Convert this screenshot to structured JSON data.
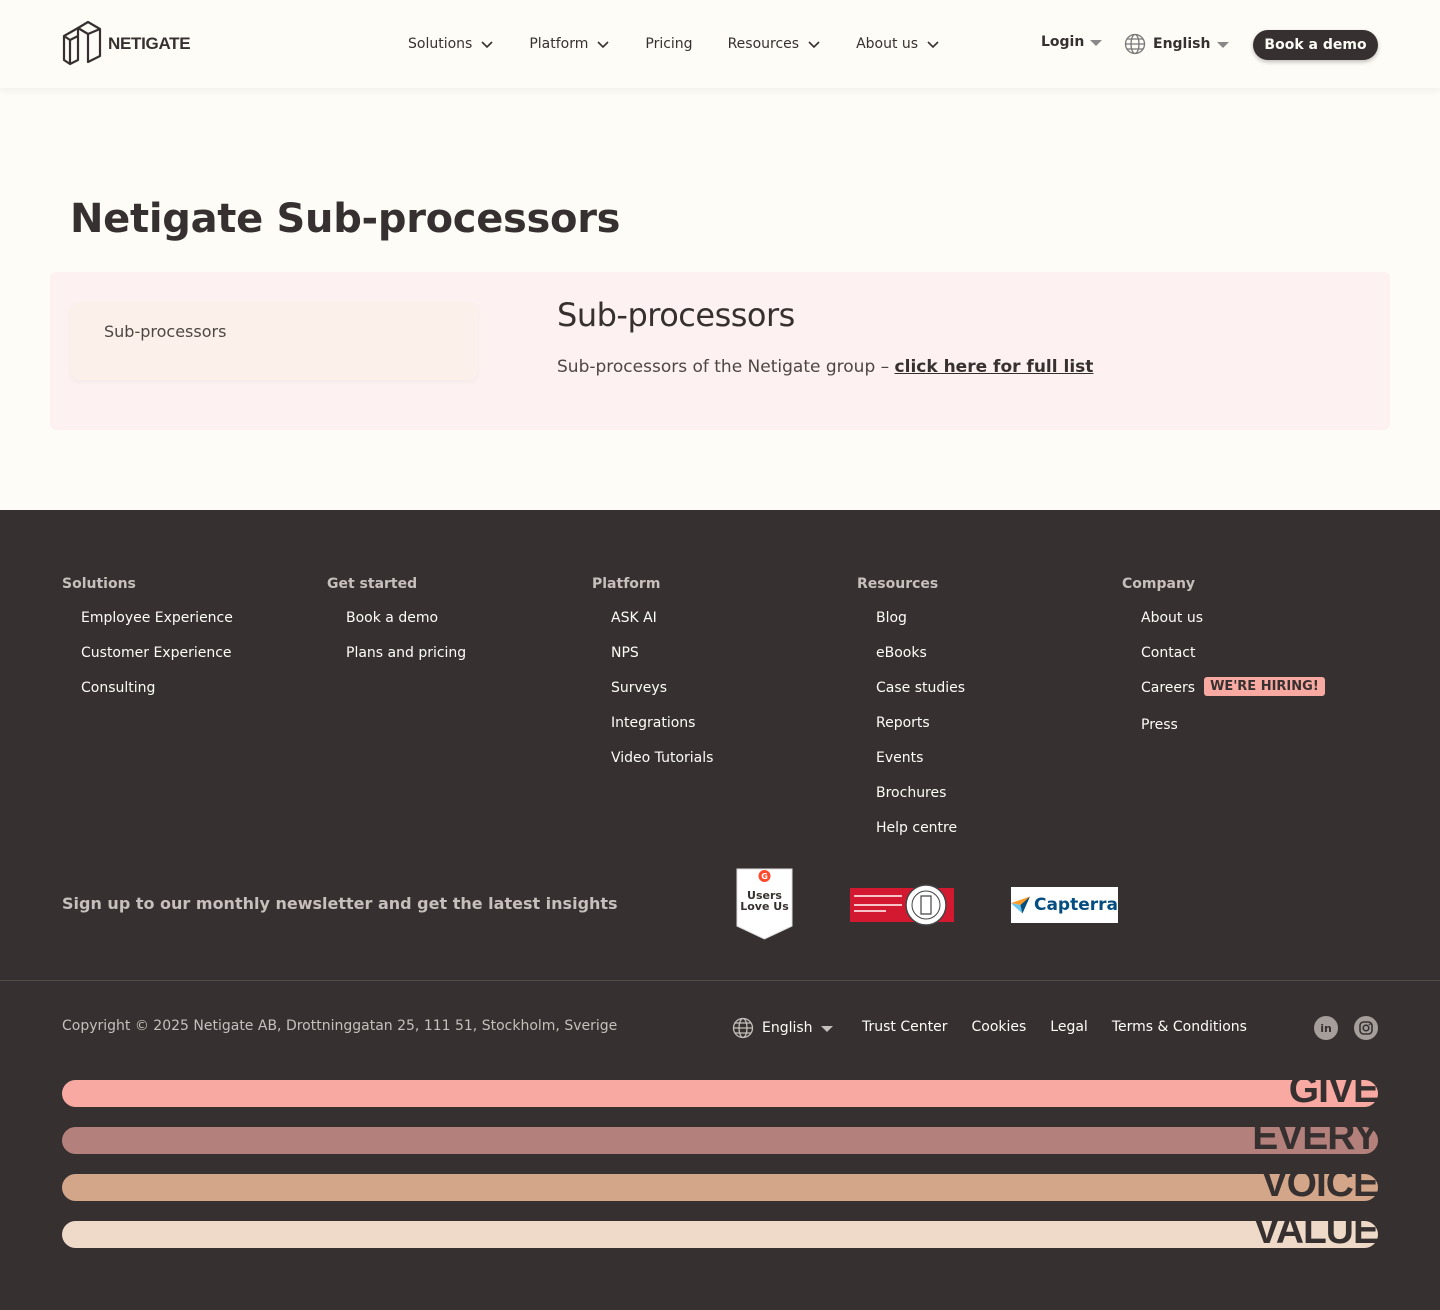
{
  "header": {
    "logo_text": "NETIGATE",
    "nav": [
      {
        "label": "Solutions",
        "has_dropdown": true
      },
      {
        "label": "Platform",
        "has_dropdown": true
      },
      {
        "label": "Pricing",
        "has_dropdown": false
      },
      {
        "label": "Resources",
        "has_dropdown": true
      },
      {
        "label": "About us",
        "has_dropdown": true
      }
    ],
    "login_label": "Login",
    "language_label": "English",
    "demo_button": "Book a demo"
  },
  "main": {
    "page_title": "Netigate Sub-processors",
    "side_menu": [
      "Sub-processors"
    ],
    "section_title": "Sub-processors",
    "section_text": "Sub-processors of the Netigate group – ",
    "section_link": "click here for full list"
  },
  "footer": {
    "columns": [
      {
        "title": "Solutions",
        "items": [
          "Employee Experience",
          "Customer Experience",
          "Consulting"
        ]
      },
      {
        "title": "Get started",
        "items": [
          "Book a demo",
          "Plans and pricing"
        ]
      },
      {
        "title": "Platform",
        "items": [
          "ASK AI",
          "NPS",
          "Surveys",
          "Integrations",
          "Video Tutorials"
        ]
      },
      {
        "title": "Resources",
        "items": [
          "Blog",
          "eBooks",
          "Case studies",
          "Reports",
          "Events",
          "Brochures",
          "Help centre"
        ]
      },
      {
        "title": "Company",
        "items": [
          "About us",
          "Contact",
          "Careers",
          "Press"
        ]
      }
    ],
    "hiring_badge": "WE'RE HIRING!",
    "newsletter_text": "Sign up to our monthly newsletter and get the latest insights",
    "badges": {
      "g2_line1": "Users",
      "g2_line2": "Love Us",
      "capterra": "Capterra"
    },
    "copyright": "Copyright © 2025 Netigate AB, Drottninggatan 25, 111 51, Stockholm, Sverige",
    "language_label": "English",
    "links": [
      "Trust Center",
      "Cookies",
      "Legal",
      "Terms & Conditions"
    ],
    "social": [
      "in",
      "ig"
    ],
    "slogan": [
      {
        "word": "GIVE",
        "color": "#f8a9a1"
      },
      {
        "word": "EVERY",
        "color": "#b3807b"
      },
      {
        "word": "VOICE",
        "color": "#d3a68a"
      },
      {
        "word": "VALUE",
        "color": "#efd9c8"
      }
    ]
  }
}
